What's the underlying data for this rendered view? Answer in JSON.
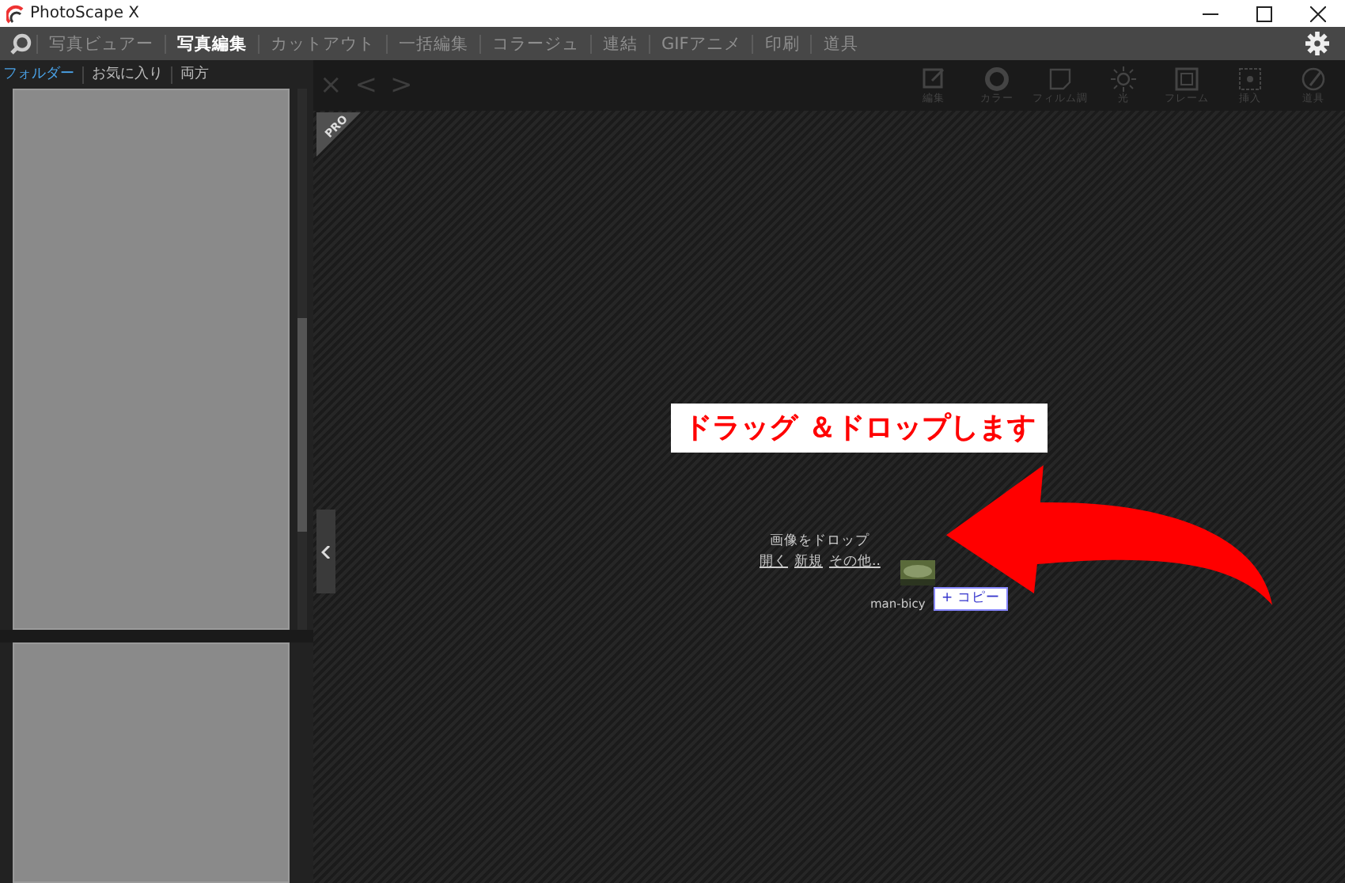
{
  "window": {
    "title": "PhotoScape X"
  },
  "menu_tabs": [
    {
      "label": "写真ビュアー",
      "selected": false
    },
    {
      "label": "写真編集",
      "selected": true
    },
    {
      "label": "カットアウト",
      "selected": false
    },
    {
      "label": "一括編集",
      "selected": false
    },
    {
      "label": "コラージュ",
      "selected": false
    },
    {
      "label": "連結",
      "selected": false
    },
    {
      "label": "GIFアニメ",
      "selected": false
    },
    {
      "label": "印刷",
      "selected": false
    },
    {
      "label": "道具",
      "selected": false
    }
  ],
  "panel_tabs": [
    {
      "label": "フォルダー",
      "selected": true
    },
    {
      "label": "お気に入り",
      "selected": false
    },
    {
      "label": "両方",
      "selected": false
    }
  ],
  "nav": [
    "×",
    "<",
    ">"
  ],
  "tools": [
    {
      "kind": "edit",
      "label": "編集"
    },
    {
      "kind": "color",
      "label": "カラー"
    },
    {
      "kind": "film",
      "label": "フィルム調"
    },
    {
      "kind": "light",
      "label": "光"
    },
    {
      "kind": "frame",
      "label": "フレーム"
    },
    {
      "kind": "insert",
      "label": "挿入"
    },
    {
      "kind": "tool",
      "label": "道具"
    }
  ],
  "badge": "PRO",
  "drop_zone": {
    "prompt": "画像をドロップ",
    "links": [
      "開く",
      "新規",
      "その他.."
    ]
  },
  "dragged_file": {
    "name": "man-bicy",
    "copy_label": "+ コピー"
  },
  "callout": "ドラッグ ＆ドロップします"
}
